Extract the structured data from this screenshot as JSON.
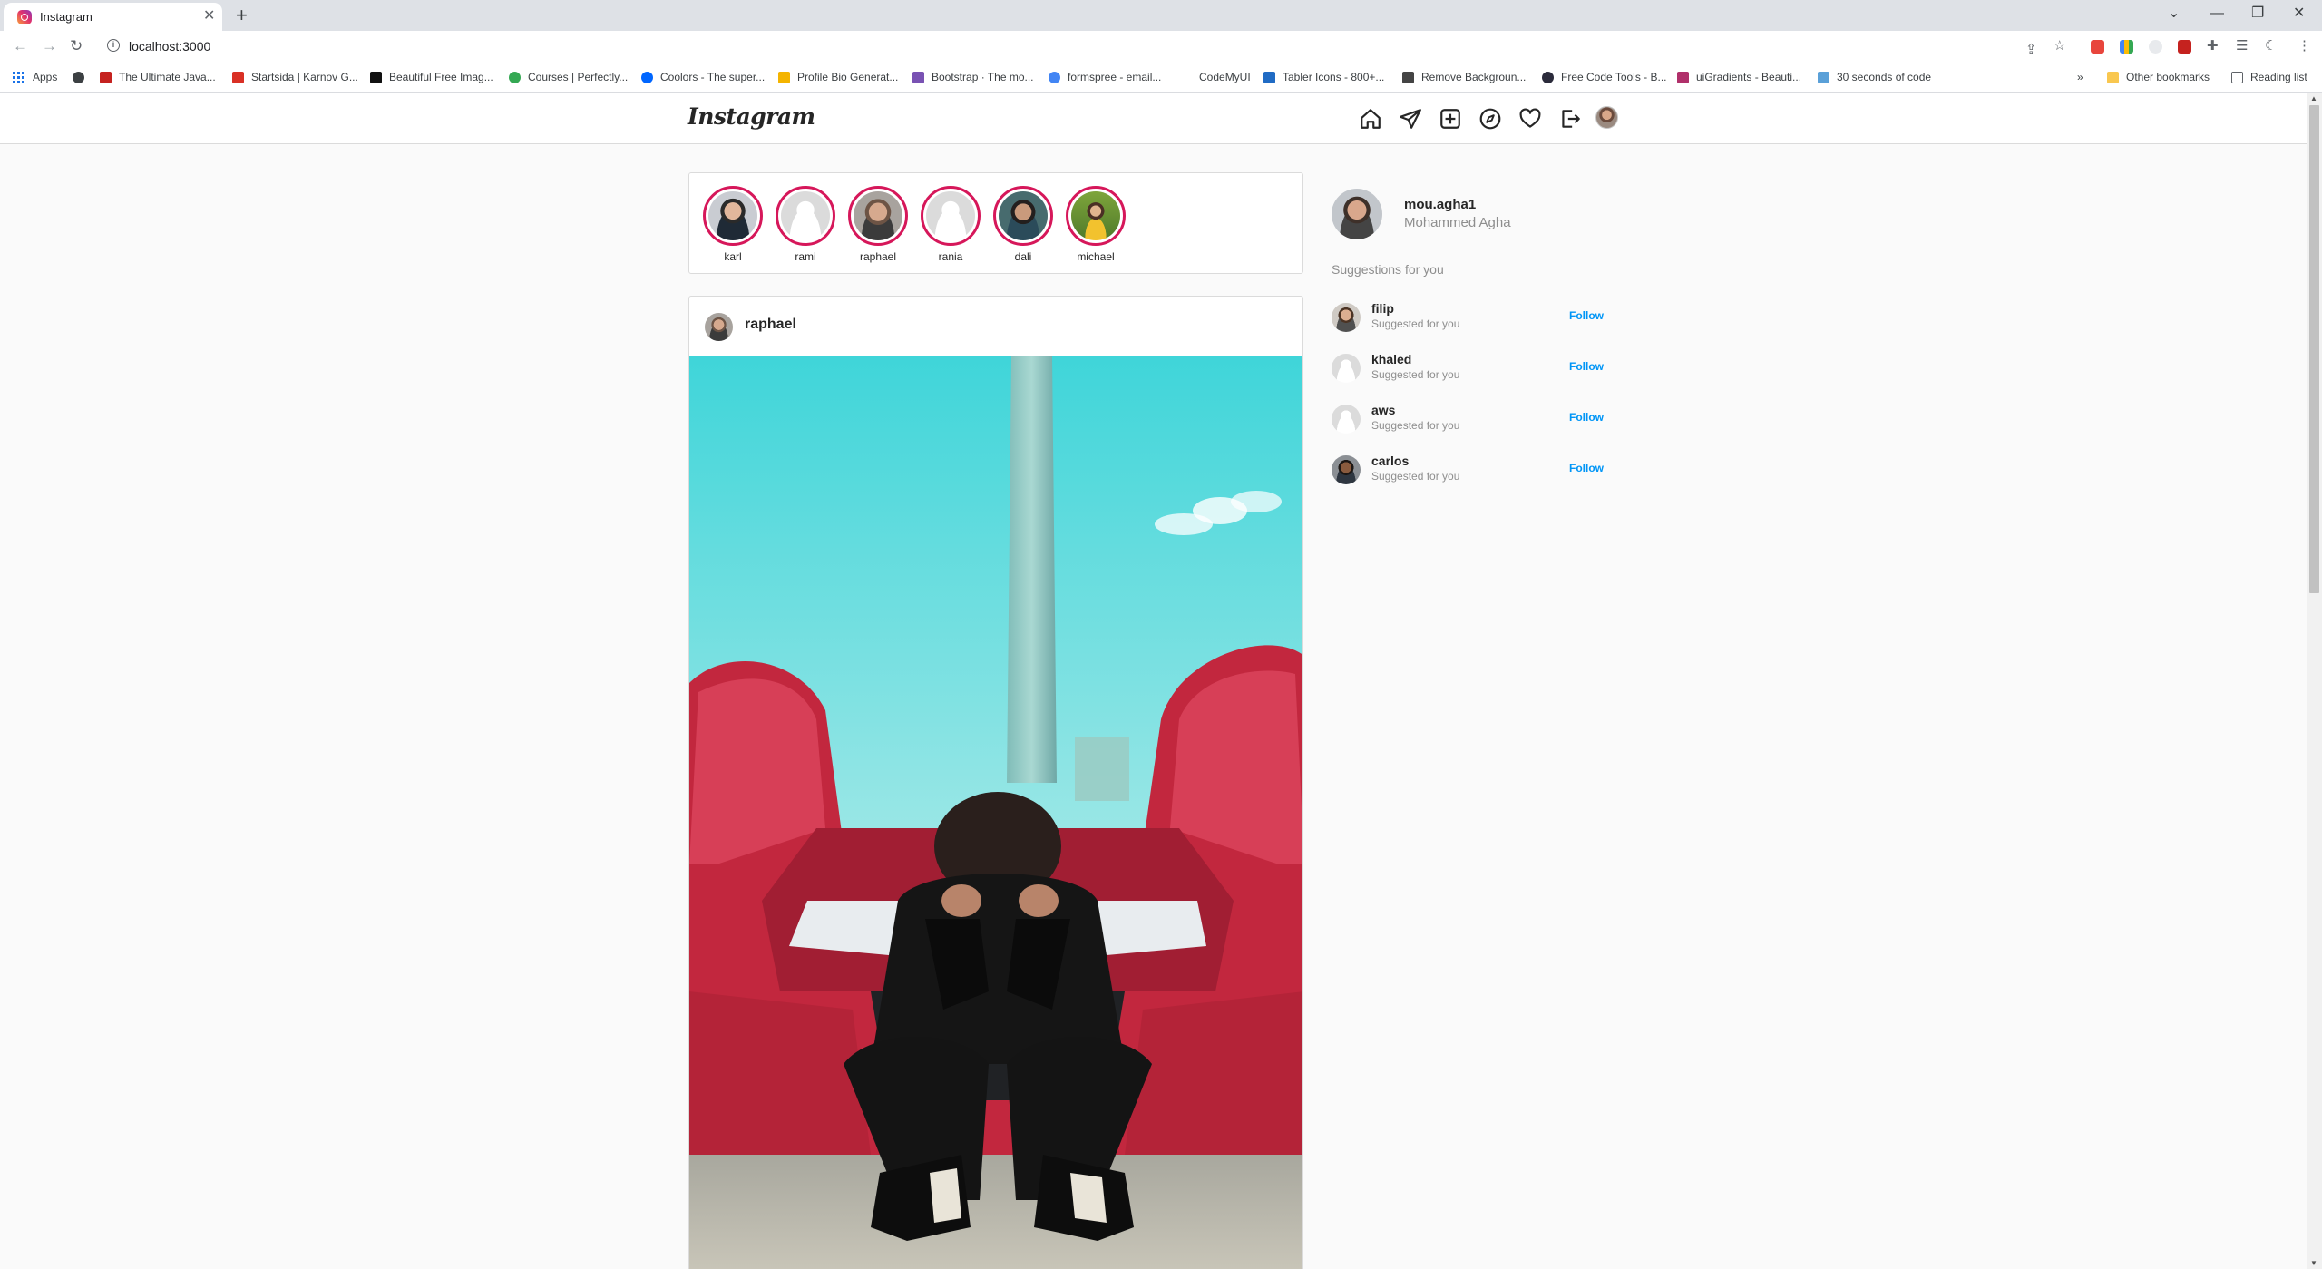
{
  "browser": {
    "tab_title": "Instagram",
    "tab_close": "✕",
    "new_tab": "+",
    "url": "localhost:3000",
    "window_controls": [
      "⌄",
      "—",
      "❐",
      "✕"
    ],
    "bookmarks": [
      {
        "label": "Apps",
        "icon": "apps-grid-icon",
        "color": "#1a73e8"
      },
      {
        "label": "",
        "icon": "globe-icon",
        "color": "#3c4043"
      },
      {
        "label": "The Ultimate Java...",
        "icon": "gmail-icon",
        "color": "#c5221f"
      },
      {
        "label": "Startsida | Karnov G...",
        "icon": "shield-icon",
        "color": "#d93025"
      },
      {
        "label": "Beautiful Free Imag...",
        "icon": "unsplash-icon",
        "color": "#111111"
      },
      {
        "label": "Courses | Perfectly...",
        "icon": "location-icon",
        "color": "#34a853"
      },
      {
        "label": "Coolors - The super...",
        "icon": "coolors-icon",
        "color": "#0066ff"
      },
      {
        "label": "Profile Bio Generat...",
        "icon": "spark-icon",
        "color": "#f4b400"
      },
      {
        "label": "Bootstrap · The mo...",
        "icon": "bootstrap-icon",
        "color": "#7952b3"
      },
      {
        "label": "formspree - email...",
        "icon": "google-icon",
        "color": "#4285f4"
      },
      {
        "label": "CodeMyUI",
        "icon": "",
        "color": ""
      },
      {
        "label": "Tabler Icons - 800+...",
        "icon": "tabler-icon",
        "color": "#206bc4"
      },
      {
        "label": "Remove Backgroun...",
        "icon": "removebg-icon",
        "color": "#444444"
      },
      {
        "label": "Free Code Tools - B...",
        "icon": "hexagon-icon",
        "color": "#2b2b3b"
      },
      {
        "label": "uiGradients - Beauti...",
        "icon": "uigradients-icon",
        "color": "#b0306a"
      },
      {
        "label": "30 seconds of code",
        "icon": "thirty-icon",
        "color": "#5aa0d8"
      }
    ],
    "overflow": "»",
    "other_bookmarks": "Other bookmarks",
    "reading_list": "Reading list"
  },
  "instagram": {
    "logo": "Instagram",
    "stories": [
      {
        "name": "karl",
        "avatar": "karl"
      },
      {
        "name": "rami",
        "avatar": "blank"
      },
      {
        "name": "raphael",
        "avatar": "raphael"
      },
      {
        "name": "rania",
        "avatar": "blank"
      },
      {
        "name": "dali",
        "avatar": "dali"
      },
      {
        "name": "michael",
        "avatar": "michael"
      }
    ],
    "post": {
      "username": "raphael"
    },
    "current_user": {
      "username": "mou.agha1",
      "full_name": "Mohammed Agha"
    },
    "suggestions_title": "Suggestions for you",
    "suggestions": [
      {
        "username": "filip",
        "subtitle": "Suggested for you",
        "action": "Follow",
        "avatar": "filip"
      },
      {
        "username": "khaled",
        "subtitle": "Suggested for you",
        "action": "Follow",
        "avatar": "blank"
      },
      {
        "username": "aws",
        "subtitle": "Suggested for you",
        "action": "Follow",
        "avatar": "blank"
      },
      {
        "username": "carlos",
        "subtitle": "Suggested for you",
        "action": "Follow",
        "avatar": "carlos"
      }
    ]
  },
  "colors": {
    "story_ring": "#d6175a",
    "follow_link": "#0095f6",
    "page_background": "#fafafa",
    "border": "#dbdbdb"
  }
}
